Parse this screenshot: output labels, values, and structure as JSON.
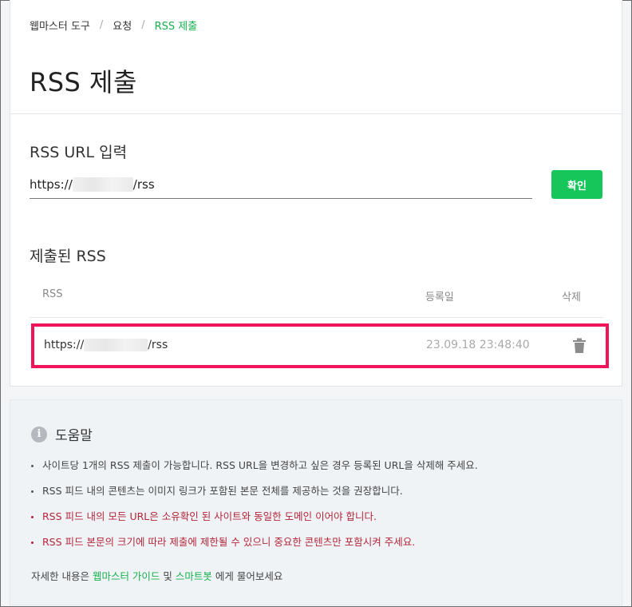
{
  "breadcrumb": {
    "items": [
      "웹마스터 도구",
      "요청"
    ],
    "current": "RSS 제출",
    "separator": "/"
  },
  "page_title": "RSS 제출",
  "rss_input": {
    "section_title": "RSS URL 입력",
    "value_prefix": "https://",
    "value_suffix": "/rss",
    "button_label": "확인"
  },
  "submitted": {
    "section_title": "제출된 RSS",
    "columns": {
      "rss": "RSS",
      "date": "등록일",
      "delete": "삭제"
    },
    "rows": [
      {
        "url_prefix": "https://",
        "url_suffix": "/rss",
        "date": "23.09.18 23:48:40",
        "delete_icon": "trash-icon"
      }
    ]
  },
  "help": {
    "title": "도움말",
    "icon": "info-icon",
    "items": [
      "사이트당 1개의 RSS 제출이 가능합니다. RSS URL을 변경하고 싶은 경우 등록된 URL을 삭제해 주세요.",
      "RSS 피드 내의 콘텐츠는 이미지 링크가 포함된 본문 전체를 제공하는 것을 권장합니다.",
      "RSS 피드 내의 모든 URL은 소유확인 된 사이트와 동일한 도메인 이어야 합니다.",
      "RSS 피드 본문의 크기에 따라 제출에 제한될 수 있으니 중요한 콘텐츠만 포함시켜 주세요."
    ],
    "footer": {
      "prefix": "자세한 내용은 ",
      "link1": "웹마스터 가이드",
      "middle": " 및 ",
      "link2": "스마트봇",
      "suffix": " 에게 물어보세요"
    }
  },
  "colors": {
    "accent": "#16c65a",
    "highlight_border": "#f0145a",
    "warning_text": "#b3263a"
  }
}
